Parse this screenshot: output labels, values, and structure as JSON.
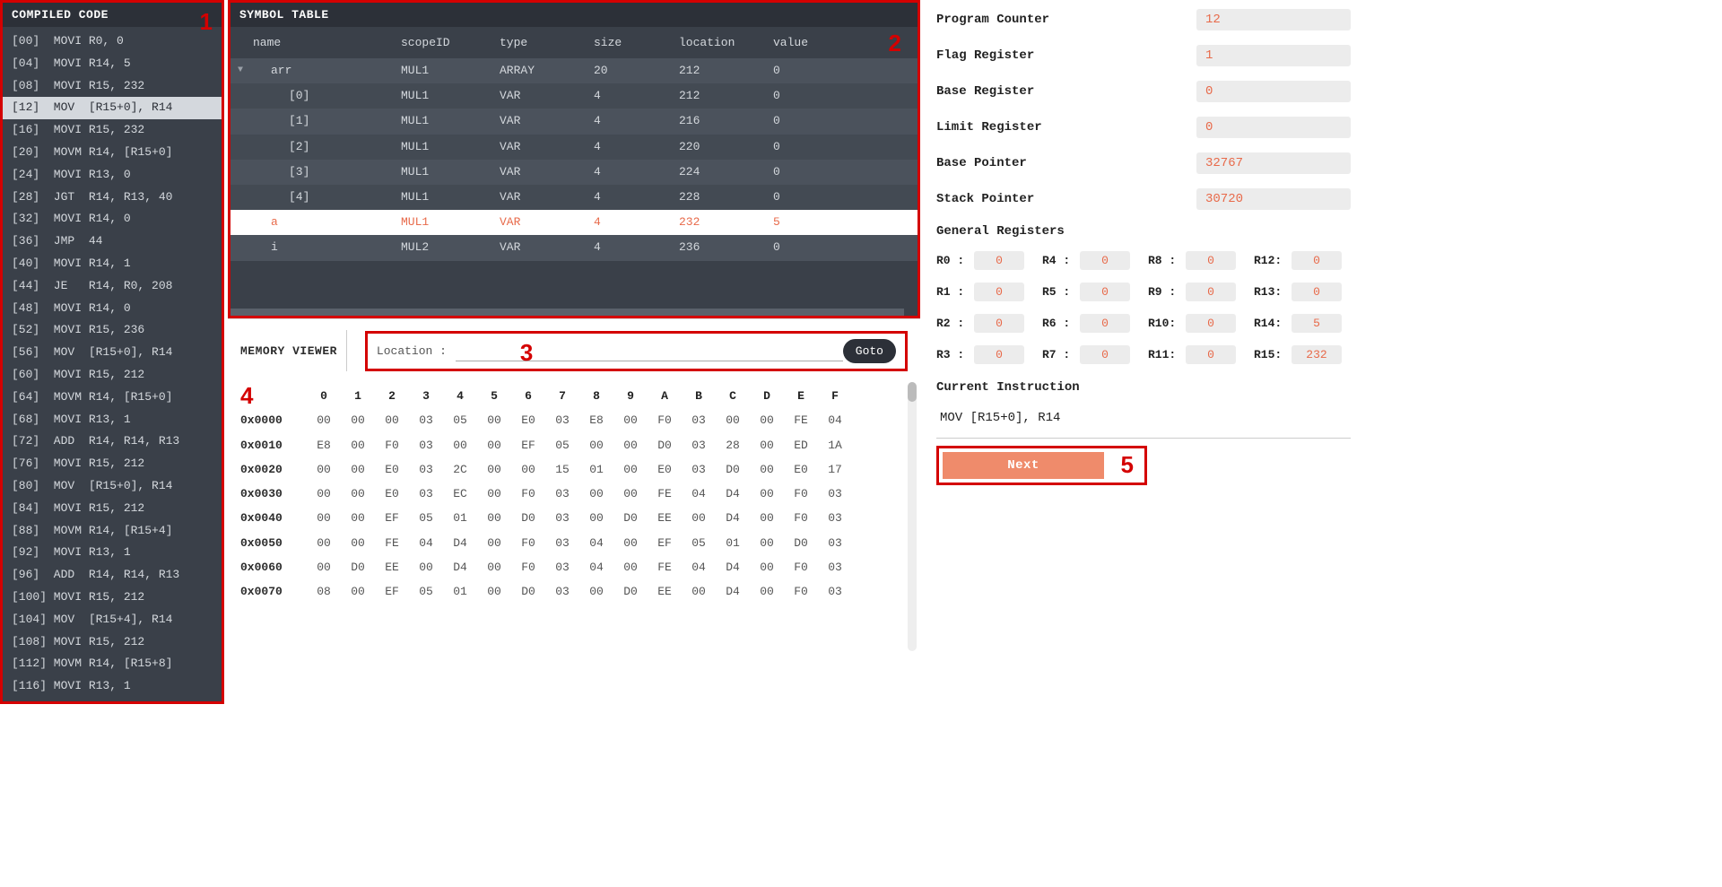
{
  "compiled_code": {
    "title": "COMPILED CODE",
    "current_index": 3,
    "lines": [
      "[00]  MOVI R0, 0",
      "[04]  MOVI R14, 5",
      "[08]  MOVI R15, 232",
      "[12]  MOV  [R15+0], R14",
      "[16]  MOVI R15, 232",
      "[20]  MOVM R14, [R15+0]",
      "[24]  MOVI R13, 0",
      "[28]  JGT  R14, R13, 40",
      "[32]  MOVI R14, 0",
      "[36]  JMP  44",
      "[40]  MOVI R14, 1",
      "[44]  JE   R14, R0, 208",
      "[48]  MOVI R14, 0",
      "[52]  MOVI R15, 236",
      "[56]  MOV  [R15+0], R14",
      "[60]  MOVI R15, 212",
      "[64]  MOVM R14, [R15+0]",
      "[68]  MOVI R13, 1",
      "[72]  ADD  R14, R14, R13",
      "[76]  MOVI R15, 212",
      "[80]  MOV  [R15+0], R14",
      "[84]  MOVI R15, 212",
      "[88]  MOVM R14, [R15+4]",
      "[92]  MOVI R13, 1",
      "[96]  ADD  R14, R14, R13",
      "[100] MOVI R15, 212",
      "[104] MOV  [R15+4], R14",
      "[108] MOVI R15, 212",
      "[112] MOVM R14, [R15+8]",
      "[116] MOVI R13, 1"
    ]
  },
  "symbol_table": {
    "title": "SYMBOL TABLE",
    "columns": {
      "name": "name",
      "scope": "scopeID",
      "type": "type",
      "size": "size",
      "location": "location",
      "value": "value"
    },
    "rows": [
      {
        "name": "arr",
        "indent": 0,
        "scope": "MUL1",
        "type": "ARRAY",
        "size": "20",
        "location": "212",
        "value": "0",
        "caret": true,
        "cls": "dark"
      },
      {
        "name": "[0]",
        "indent": 1,
        "scope": "MUL1",
        "type": "VAR",
        "size": "4",
        "location": "212",
        "value": "0",
        "cls": "darker"
      },
      {
        "name": "[1]",
        "indent": 1,
        "scope": "MUL1",
        "type": "VAR",
        "size": "4",
        "location": "216",
        "value": "0",
        "cls": "dark"
      },
      {
        "name": "[2]",
        "indent": 1,
        "scope": "MUL1",
        "type": "VAR",
        "size": "4",
        "location": "220",
        "value": "0",
        "cls": "darker"
      },
      {
        "name": "[3]",
        "indent": 1,
        "scope": "MUL1",
        "type": "VAR",
        "size": "4",
        "location": "224",
        "value": "0",
        "cls": "dark"
      },
      {
        "name": "[4]",
        "indent": 1,
        "scope": "MUL1",
        "type": "VAR",
        "size": "4",
        "location": "228",
        "value": "0",
        "cls": "darker"
      },
      {
        "name": "a",
        "indent": 0,
        "scope": "MUL1",
        "type": "VAR",
        "size": "4",
        "location": "232",
        "value": "5",
        "cls": "selected"
      },
      {
        "name": "i",
        "indent": 0,
        "scope": "MUL2",
        "type": "VAR",
        "size": "4",
        "location": "236",
        "value": "0",
        "cls": "dark"
      }
    ]
  },
  "memory_viewer": {
    "title": "MEMORY VIEWER",
    "location_label": "Location :",
    "goto_label": "Goto",
    "headers": [
      "0",
      "1",
      "2",
      "3",
      "4",
      "5",
      "6",
      "7",
      "8",
      "9",
      "A",
      "B",
      "C",
      "D",
      "E",
      "F"
    ],
    "rows": [
      {
        "addr": "0x0000",
        "cells": [
          "00",
          "00",
          "00",
          "03",
          "05",
          "00",
          "E0",
          "03",
          "E8",
          "00",
          "F0",
          "03",
          "00",
          "00",
          "FE",
          "04"
        ]
      },
      {
        "addr": "0x0010",
        "cells": [
          "E8",
          "00",
          "F0",
          "03",
          "00",
          "00",
          "EF",
          "05",
          "00",
          "00",
          "D0",
          "03",
          "28",
          "00",
          "ED",
          "1A"
        ]
      },
      {
        "addr": "0x0020",
        "cells": [
          "00",
          "00",
          "E0",
          "03",
          "2C",
          "00",
          "00",
          "15",
          "01",
          "00",
          "E0",
          "03",
          "D0",
          "00",
          "E0",
          "17"
        ]
      },
      {
        "addr": "0x0030",
        "cells": [
          "00",
          "00",
          "E0",
          "03",
          "EC",
          "00",
          "F0",
          "03",
          "00",
          "00",
          "FE",
          "04",
          "D4",
          "00",
          "F0",
          "03"
        ]
      },
      {
        "addr": "0x0040",
        "cells": [
          "00",
          "00",
          "EF",
          "05",
          "01",
          "00",
          "D0",
          "03",
          "00",
          "D0",
          "EE",
          "00",
          "D4",
          "00",
          "F0",
          "03"
        ]
      },
      {
        "addr": "0x0050",
        "cells": [
          "00",
          "00",
          "FE",
          "04",
          "D4",
          "00",
          "F0",
          "03",
          "04",
          "00",
          "EF",
          "05",
          "01",
          "00",
          "D0",
          "03"
        ]
      },
      {
        "addr": "0x0060",
        "cells": [
          "00",
          "D0",
          "EE",
          "00",
          "D4",
          "00",
          "F0",
          "03",
          "04",
          "00",
          "FE",
          "04",
          "D4",
          "00",
          "F0",
          "03"
        ]
      },
      {
        "addr": "0x0070",
        "cells": [
          "08",
          "00",
          "EF",
          "05",
          "01",
          "00",
          "D0",
          "03",
          "00",
          "D0",
          "EE",
          "00",
          "D4",
          "00",
          "F0",
          "03"
        ]
      }
    ]
  },
  "cpu": {
    "pc": {
      "label": "Program Counter",
      "value": "12"
    },
    "flag": {
      "label": "Flag Register",
      "value": "1"
    },
    "base": {
      "label": "Base Register",
      "value": "0"
    },
    "limit": {
      "label": "Limit Register",
      "value": "0"
    },
    "bp": {
      "label": "Base Pointer",
      "value": "32767"
    },
    "sp": {
      "label": "Stack Pointer",
      "value": "30720"
    },
    "gr_title": "General Registers",
    "registers": [
      {
        "lbl": "R0 :",
        "val": "0"
      },
      {
        "lbl": "R4 :",
        "val": "0"
      },
      {
        "lbl": "R8 :",
        "val": "0"
      },
      {
        "lbl": "R12:",
        "val": "0"
      },
      {
        "lbl": "R1 :",
        "val": "0"
      },
      {
        "lbl": "R5 :",
        "val": "0"
      },
      {
        "lbl": "R9 :",
        "val": "0"
      },
      {
        "lbl": "R13:",
        "val": "0"
      },
      {
        "lbl": "R2 :",
        "val": "0"
      },
      {
        "lbl": "R6 :",
        "val": "0"
      },
      {
        "lbl": "R10:",
        "val": "0"
      },
      {
        "lbl": "R14:",
        "val": "5"
      },
      {
        "lbl": "R3 :",
        "val": "0"
      },
      {
        "lbl": "R7 :",
        "val": "0"
      },
      {
        "lbl": "R11:",
        "val": "0"
      },
      {
        "lbl": "R15:",
        "val": "232"
      }
    ],
    "cur_instr_title": "Current Instruction",
    "cur_instr": "MOV [R15+0], R14",
    "next_label": "Next"
  },
  "annotations": {
    "a1": "1",
    "a2": "2",
    "a3": "3",
    "a4": "4",
    "a5": "5"
  }
}
